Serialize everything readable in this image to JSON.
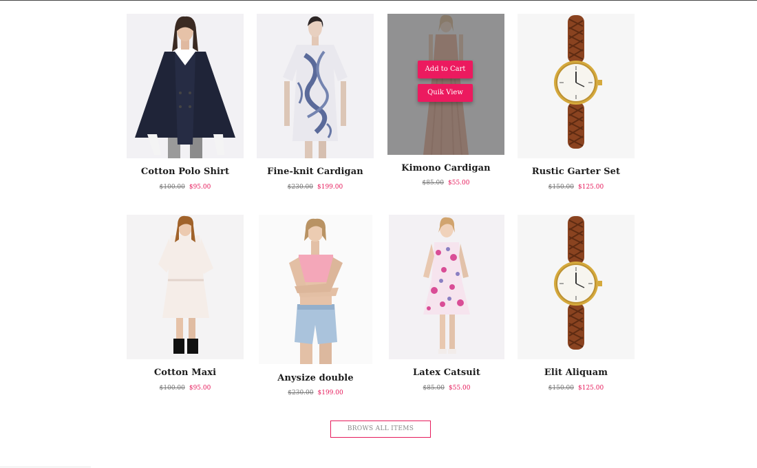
{
  "colors": {
    "accent": "#e6195a",
    "old_price": "#777777",
    "title": "#1c1c1c"
  },
  "products": [
    {
      "name": "Cotton Polo Shirt",
      "old_price": "$100.00",
      "new_price": "$95.00",
      "image": "woman-black-coat"
    },
    {
      "name": "Fine-knit Cardigan",
      "old_price": "$230.00",
      "new_price": "$199.00",
      "image": "woman-dragon-print-dress"
    },
    {
      "name": "Kimono Cardigan",
      "old_price": "$85.00",
      "new_price": "$55.00",
      "image": "woman-peach-gown",
      "hover": {
        "add_to_cart": "Add to Cart",
        "quick_view": "Quik View"
      }
    },
    {
      "name": "Rustic Garter Set",
      "old_price": "$150.00",
      "new_price": "$125.00",
      "image": "braided-leather-watch"
    },
    {
      "name": "Cotton Maxi",
      "old_price": "$100.00",
      "new_price": "$95.00",
      "image": "woman-white-dress"
    },
    {
      "name": "Anysize double",
      "old_price": "$230.00",
      "new_price": "$199.00",
      "image": "woman-pink-top-denim-shorts"
    },
    {
      "name": "Latex Catsuit",
      "old_price": "$85.00",
      "new_price": "$55.00",
      "image": "woman-floral-dress"
    },
    {
      "name": "Elit Aliquam",
      "old_price": "$150.00",
      "new_price": "$125.00",
      "image": "braided-leather-watch"
    }
  ],
  "browse_button": "BROWS ALL ITEMS"
}
